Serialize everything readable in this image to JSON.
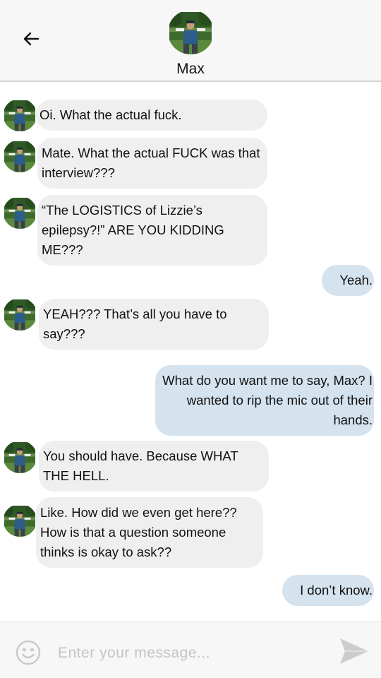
{
  "header": {
    "contact_name": "Max",
    "back_icon": "arrow-left-icon"
  },
  "messages": [
    {
      "sender": "contact",
      "text": "Oi. What the actual fuck."
    },
    {
      "sender": "contact",
      "text": "Mate. What the actual FUCK was that interview???"
    },
    {
      "sender": "contact",
      "text": "“The LOGISTICS of Lizzie’s epilepsy?!” ARE YOU KIDDING ME???"
    },
    {
      "sender": "me",
      "text": "Yeah."
    },
    {
      "sender": "contact",
      "text": "YEAH??? That’s all you have to say???"
    },
    {
      "sender": "me",
      "text": "What do you want me to say, Max? I wanted to rip the mic out of their hands."
    },
    {
      "sender": "contact",
      "text": "You should have. Because WHAT THE HELL."
    },
    {
      "sender": "contact",
      "text": "Like. How did we even get here?? How is that a question someone thinks is okay to ask??"
    },
    {
      "sender": "me",
      "text": "I don’t know."
    }
  ],
  "composer": {
    "placeholder": "Enter your message...",
    "value": "",
    "emoji_icon": "smiley-face-icon",
    "send_icon": "send-arrow-icon"
  },
  "colors": {
    "incoming_bubble": "#efefef",
    "outgoing_bubble": "#d5e3ee",
    "header_background": "#f7f7f7"
  }
}
